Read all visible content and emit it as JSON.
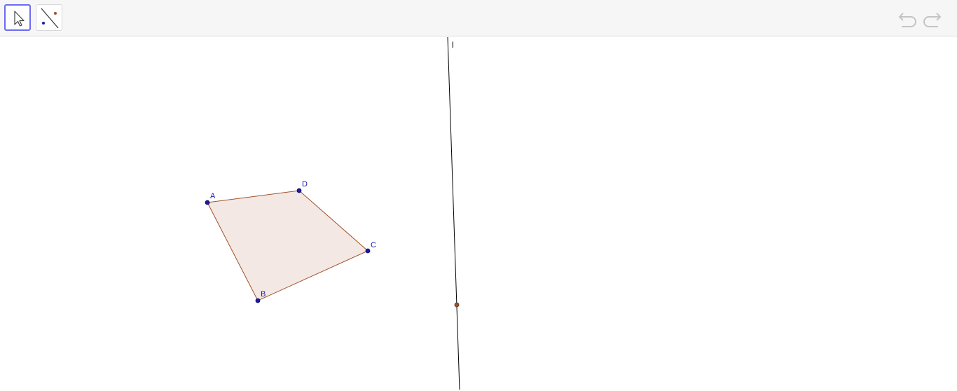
{
  "app": {
    "toolbar": {
      "tools": [
        {
          "name": "move",
          "icon": "arrow-pointer-icon",
          "active": true
        },
        {
          "name": "reflect-about-line",
          "icon": "reflect-about-line-icon",
          "active": false
        }
      ],
      "undo_icon": "undo-icon",
      "redo_icon": "redo-icon"
    },
    "graphics": {
      "polygon": {
        "fill": "#f3e8e3",
        "stroke": "#a0522d",
        "vertices": [
          "A",
          "B",
          "C",
          "D"
        ]
      },
      "point_color": "#1a1aa6",
      "line": {
        "label": "l",
        "color": "#000000"
      },
      "line_point_color": "#a0522d"
    }
  }
}
